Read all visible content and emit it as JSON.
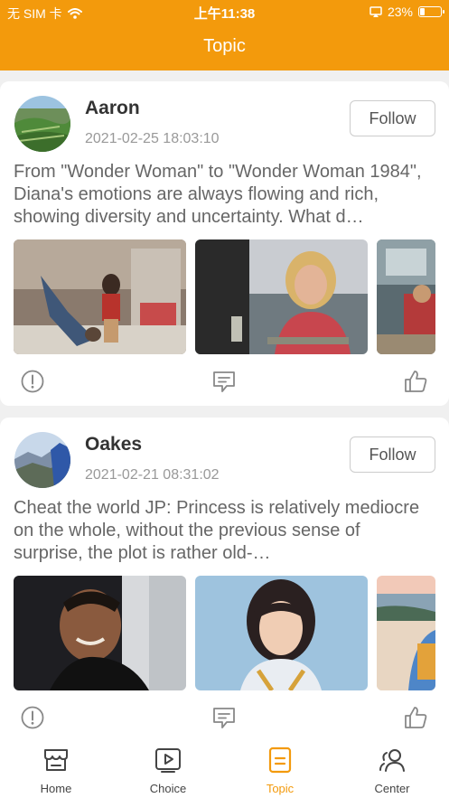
{
  "status_bar": {
    "carrier": "无 SIM 卡",
    "time": "上午11:38",
    "battery": "23%",
    "battery_level": 0.23
  },
  "header": {
    "title": "Topic"
  },
  "posts": [
    {
      "username": "Aaron",
      "timestamp": "2021-02-25 18:03:10",
      "follow_label": "Follow",
      "text": "From \"Wonder Woman\" to \"Wonder Woman 1984\", Diana's emotions are always flowing and rich, showing diversity and uncertainty. What d…",
      "images": [
        "wonder-woman-mall-scene",
        "dinner-scene-woman-smiling",
        "mall-scene-partial"
      ]
    },
    {
      "username": "Oakes",
      "timestamp": "2021-02-21 08:31:02",
      "follow_label": "Follow",
      "text": "Cheat the world JP: Princess is relatively mediocre on the whole, without the previous sense of surprise, the plot is rather old-…",
      "images": [
        "man-laughing-scene",
        "young-woman-smiling-scene",
        "beach-scene-partial"
      ]
    }
  ],
  "tabbar": {
    "tabs": [
      {
        "label": "Home",
        "icon": "store-icon"
      },
      {
        "label": "Choice",
        "icon": "play-icon"
      },
      {
        "label": "Topic",
        "icon": "document-icon"
      },
      {
        "label": "Center",
        "icon": "users-icon"
      }
    ],
    "active": "Topic"
  },
  "colors": {
    "accent": "#f39a0c",
    "background": "#f0f0f0",
    "card": "#ffffff",
    "text_secondary": "#999999"
  }
}
